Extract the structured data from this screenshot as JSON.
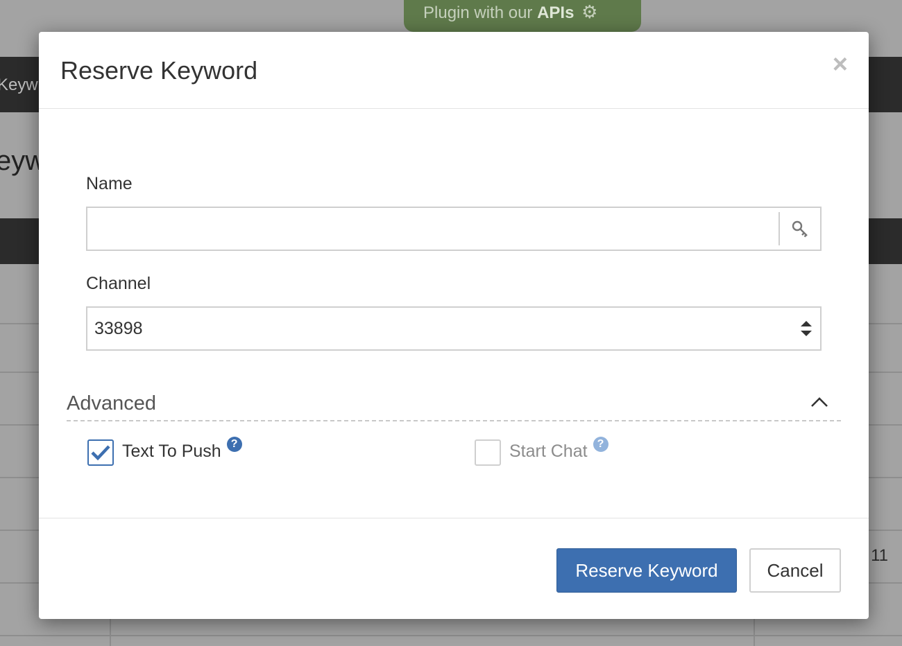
{
  "background": {
    "tab_fragment": "Keyw",
    "title_fragment": "eyw",
    "plugin_banner": {
      "prefix": "Plugin with our ",
      "bold": "APIs"
    },
    "number_fragment": "11"
  },
  "modal": {
    "title": "Reserve Keyword",
    "close_icon": "×",
    "name": {
      "label": "Name",
      "value": "",
      "placeholder": ""
    },
    "channel": {
      "label": "Channel",
      "value": "33898"
    },
    "advanced": {
      "label": "Advanced",
      "expanded": true
    },
    "options": [
      {
        "label": "Text To Push",
        "checked": true,
        "help": "?"
      },
      {
        "label": "Start Chat",
        "checked": false,
        "help": "?"
      }
    ],
    "footer": {
      "primary_label": "Reserve Keyword",
      "cancel_label": "Cancel"
    }
  },
  "colors": {
    "primary": "#3d6fb0",
    "banner": "#5f7a4b",
    "dark_bar": "#2b2b2b"
  },
  "icons": {
    "name_addon": "key-icon",
    "channel_select": "sort-arrows-icon",
    "advanced_toggle": "chevron-up-icon",
    "banner": "gears-icon"
  }
}
